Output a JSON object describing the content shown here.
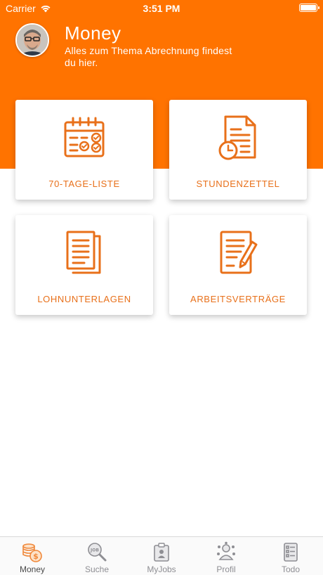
{
  "status_bar": {
    "carrier": "Carrier",
    "time": "3:51 PM"
  },
  "header": {
    "title": "Money",
    "subtitle": "Alles zum Thema Abrechnung findest du hier."
  },
  "colors": {
    "brand": "#ff7300",
    "accent_text": "#e8701a",
    "tab_inactive": "#8e8e93"
  },
  "tiles": [
    {
      "label": "70-TAGE-LISTE",
      "icon": "calendar-icon"
    },
    {
      "label": "STUNDENZETTEL",
      "icon": "timesheet-icon"
    },
    {
      "label": "LOHNUNTERLAGEN",
      "icon": "documents-icon"
    },
    {
      "label": "ARBEITSVERTRÄGE",
      "icon": "contract-icon"
    }
  ],
  "tabs": [
    {
      "label": "Money",
      "icon": "money-icon",
      "active": true
    },
    {
      "label": "Suche",
      "icon": "search-icon",
      "active": false
    },
    {
      "label": "MyJobs",
      "icon": "myjobs-icon",
      "active": false
    },
    {
      "label": "Profil",
      "icon": "profile-icon",
      "active": false
    },
    {
      "label": "Todo",
      "icon": "todo-icon",
      "active": false
    }
  ]
}
